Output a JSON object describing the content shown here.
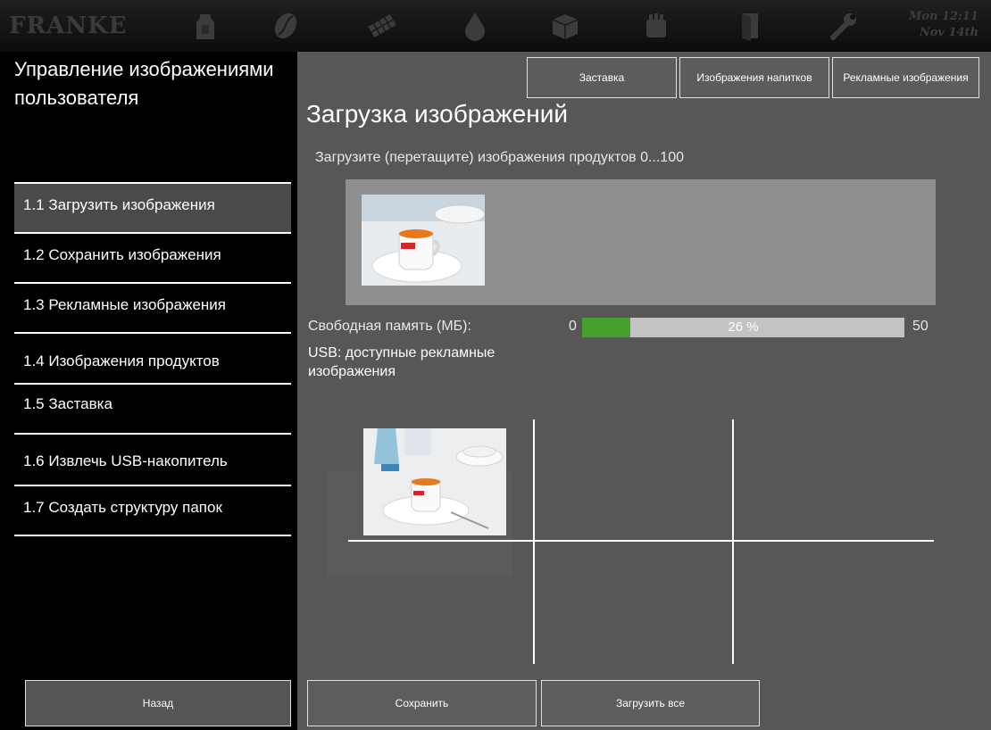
{
  "header": {
    "logo": "FRANKE",
    "clock_line1": "Mon 12:11",
    "clock_line2": "Nov 14th",
    "icons": [
      "milk-icon",
      "coffee-bean-icon",
      "chocolate-icon",
      "water-drop-icon",
      "package-icon",
      "cleaning-icon",
      "door-icon",
      "wrench-icon"
    ]
  },
  "sidebar": {
    "title": "Управление изображениями пользователя",
    "items": [
      {
        "label": "1.1 Загрузить изображения",
        "active": true
      },
      {
        "label": "1.2 Сохранить изображения",
        "active": false
      },
      {
        "label": "1.3 Рекламные изображения",
        "active": false
      },
      {
        "label": "1.4 Изображения продуктов",
        "active": false
      },
      {
        "label": "1.5 Заставка",
        "active": false
      },
      {
        "label": "1.6 Извлечь USB-накопитель",
        "active": false
      },
      {
        "label": "1.7 Создать структуру папок",
        "active": false
      }
    ],
    "back_label": "Назад"
  },
  "tabs": [
    "Заставка",
    "Изображения напитков",
    "Рекламные изображения"
  ],
  "main": {
    "title": "Загрузка изображений",
    "subtitle": "Загрузите (перетащите) изображения продуктов 0...100",
    "memory_label": "Свободная память (МБ):",
    "memory_min": "0",
    "memory_max": "50",
    "memory_percent_text": "26 %",
    "memory_fill_fraction": 0.15,
    "usb_label": "USB: доступные рекламные изображения"
  },
  "footer": {
    "save_label": "Сохранить",
    "upload_all_label": "Загрузить все"
  },
  "colors": {
    "accent_green": "#47a02c",
    "panel_gray": "#575757",
    "sidebar_bg": "#000000"
  }
}
